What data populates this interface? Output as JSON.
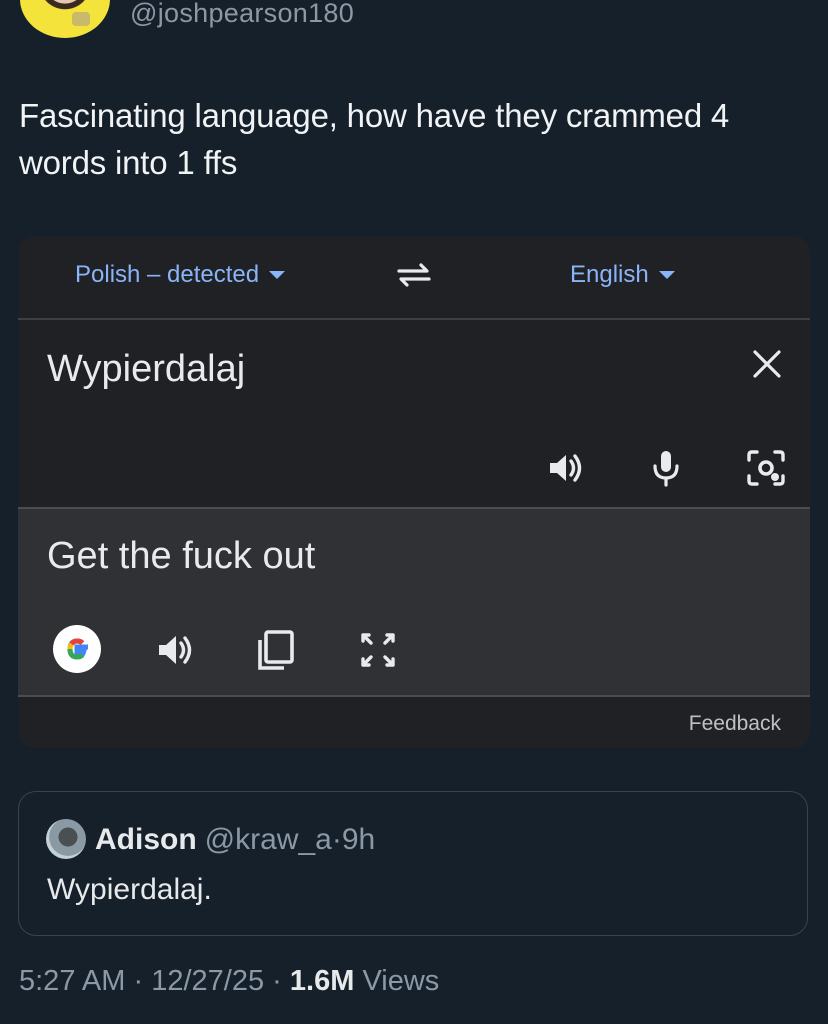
{
  "author": {
    "handle": "@joshpearson180"
  },
  "tweet": {
    "text": "Fascinating language, how have they crammed 4 words into 1 ffs"
  },
  "translate": {
    "source_language": "Polish – detected",
    "target_language": "English",
    "source_text": "Wypierdalaj",
    "translated_text": "Get the fuck out",
    "feedback_label": "Feedback",
    "icons": {
      "swap": "swap-languages-icon",
      "clear": "close-icon",
      "source_listen": "speaker-icon",
      "voice_input": "microphone-icon",
      "camera_input": "camera-icon",
      "google": "google-logo-icon",
      "result_listen": "speaker-icon",
      "copy": "copy-icon",
      "fullscreen": "fullscreen-icon"
    },
    "colors": {
      "accent": "#8ab4f8",
      "card_bg": "#202124",
      "result_bg": "#303134"
    }
  },
  "quoted_tweet": {
    "name": "Adison",
    "handle": "@kraw_a",
    "separator": "·",
    "time": "9h",
    "text": "Wypierdalaj."
  },
  "footer": {
    "time": "5:27 AM",
    "date": "12/27/25",
    "views_count": "1.6M",
    "views_label": "Views",
    "separator": "·"
  },
  "colors": {
    "background": "#15202b",
    "secondary_text": "#8b98a5"
  }
}
